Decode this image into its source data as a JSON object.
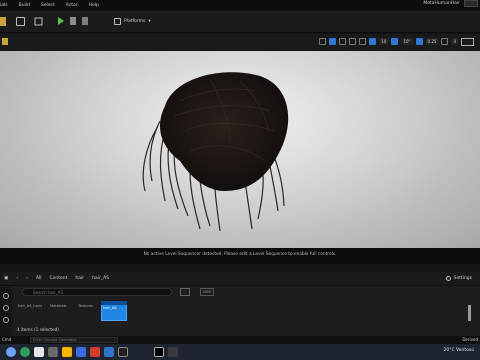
{
  "menu": {
    "items": [
      "ials",
      "Build",
      "Select",
      "Actor",
      "Help"
    ],
    "project_title": "MetaHumanHair"
  },
  "toolbar": {
    "platforms_label": "Platforms"
  },
  "viewport": {
    "tools_text": [
      "10",
      "0.25",
      "4"
    ],
    "message": "No active Level Sequencer detected. Please edit a Level Sequence to enable full controls."
  },
  "content_browser": {
    "path": [
      "All",
      "Content",
      "hair",
      "hair_AS"
    ],
    "settings_label": "Settings",
    "search_placeholder": "Search hair_AS",
    "save_label": "SAVE",
    "folders": [
      {
        "label": "hair_AS_hairs"
      },
      {
        "label": "Materials"
      },
      {
        "label": "Textures"
      }
    ],
    "selected_asset_label": "hair_AS",
    "status": "4 items (1 selected)"
  },
  "status_bar": {
    "console_label": "Cmd",
    "console_placeholder": "Enter Console Command",
    "derived_data": "Derived"
  },
  "taskbar": {
    "tray_text": "20°C  Ventoso"
  },
  "colors": {
    "accent_blue": "#1f86e6",
    "play_green": "#5bbf4b",
    "save_gold": "#c9a43d"
  }
}
